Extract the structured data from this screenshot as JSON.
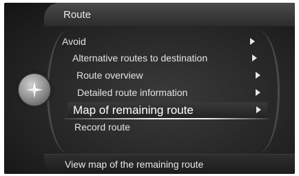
{
  "header": {
    "title": "Route"
  },
  "menu": {
    "items": [
      {
        "label": "Avoid",
        "has_submenu": true
      },
      {
        "label": "Alternative routes to destination",
        "has_submenu": true
      },
      {
        "label": "Route overview",
        "has_submenu": true
      },
      {
        "label": "Detailed route information",
        "has_submenu": true
      },
      {
        "label": "Map of remaining route",
        "has_submenu": true,
        "selected": true
      },
      {
        "label": "Record route",
        "has_submenu": false
      }
    ]
  },
  "footer": {
    "help_text": "View map of the remaining route"
  },
  "icons": {
    "knob": "compass-knob-icon",
    "submenu": "triangle-right-icon"
  }
}
